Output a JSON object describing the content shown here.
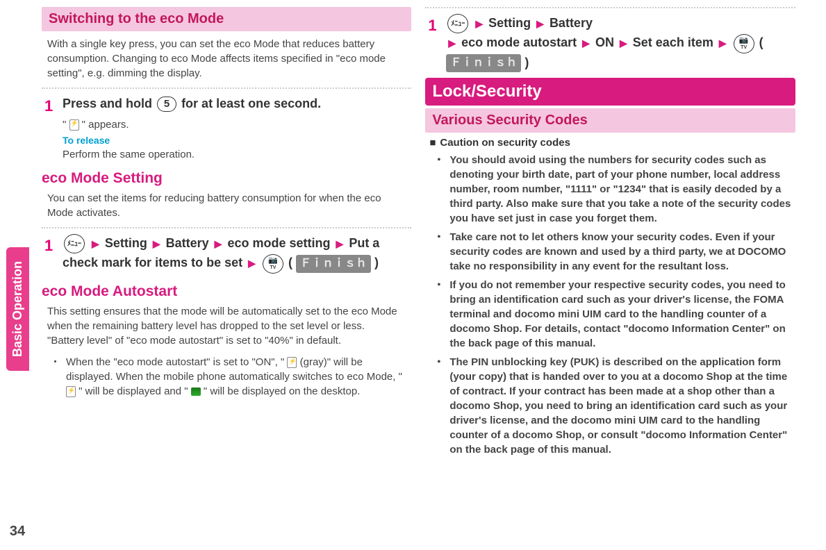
{
  "sidebar": {
    "tab": "Basic Operation"
  },
  "pageNumber": "34",
  "left": {
    "heading1": "Switching to the eco Mode",
    "intro1": "With a single key press, you can set the eco Mode that reduces battery consumption. Changing to eco Mode affects items specified in \"eco mode setting\", e.g. dimming the display.",
    "stepNum1": "1",
    "step1a": "Press and hold ",
    "step1key": "5",
    "step1b": " for at least one second.",
    "step1sub_a": "\" ",
    "step1sub_b": " \" appears.",
    "toRelease": "To release",
    "toReleaseBody": "Perform the same operation.",
    "heading2": "eco Mode Setting",
    "intro2": "You can set the items for reducing battery consumption for when the eco Mode activates.",
    "stepNum2": "1",
    "step2_menu": "ﾒﾆｭｰ",
    "step2_setting": "Setting",
    "step2_battery": "Battery",
    "step2_ecomode": "eco mode setting",
    "step2_put": "Put a check mark for items to be set",
    "step2_finish": "Ｆｉｎｉｓｈ",
    "heading3": "eco Mode Autostart",
    "intro3": "This setting ensures that the mode will be automatically set to the eco Mode when the remaining battery level has dropped to the set level or less.\n\"Battery level\" of \"eco mode autostart\" is set to \"40%\" in default.",
    "bullet3": "When the \"eco mode autostart\" is set to \"ON\", \" 🔋 (gray)\" will be displayed. When the mobile phone automatically switches to eco Mode, \" 🔋 \" will be displayed and \" ▢ \" will be displayed on the desktop."
  },
  "right": {
    "stepNum": "1",
    "menu": "ﾒﾆｭｰ",
    "setting": "Setting",
    "battery": "Battery",
    "autostart": "eco mode autostart",
    "on": "ON",
    "seteach": "Set each item",
    "finish": "Ｆｉｎｉｓｈ",
    "headMain": "Lock/Security",
    "headSub": "Various Security Codes",
    "cautionSquare": "■",
    "caution": "Caution on security codes",
    "b1": "You should avoid using the numbers for security codes such as denoting your birth date, part of your phone number, local address number, room number, \"1111\" or \"1234\" that is easily decoded by a third party. Also make sure that you take a note of the security codes you have set just in case you forget them.",
    "b2": "Take care not to let others know your security codes. Even if your security codes are known and used by a third party, we at DOCOMO take no responsibility in any event for the resultant loss.",
    "b3": "If you do not remember your respective security codes, you need to bring an identification card such as your driver's license, the FOMA terminal and docomo mini UIM card to the handling counter of a docomo Shop. For details, contact \"docomo Information Center\" on the back page of this manual.",
    "b4": "The PIN unblocking key (PUK) is described on the application form (your copy) that is handed over to you at a docomo Shop at the time of contract. If your contract has been made at a shop other than a docomo Shop, you need to bring an identification card such as your driver's license, and the docomo mini UIM card to the handling counter of a docomo Shop, or consult \"docomo Information Center\" on the back page of this manual."
  }
}
